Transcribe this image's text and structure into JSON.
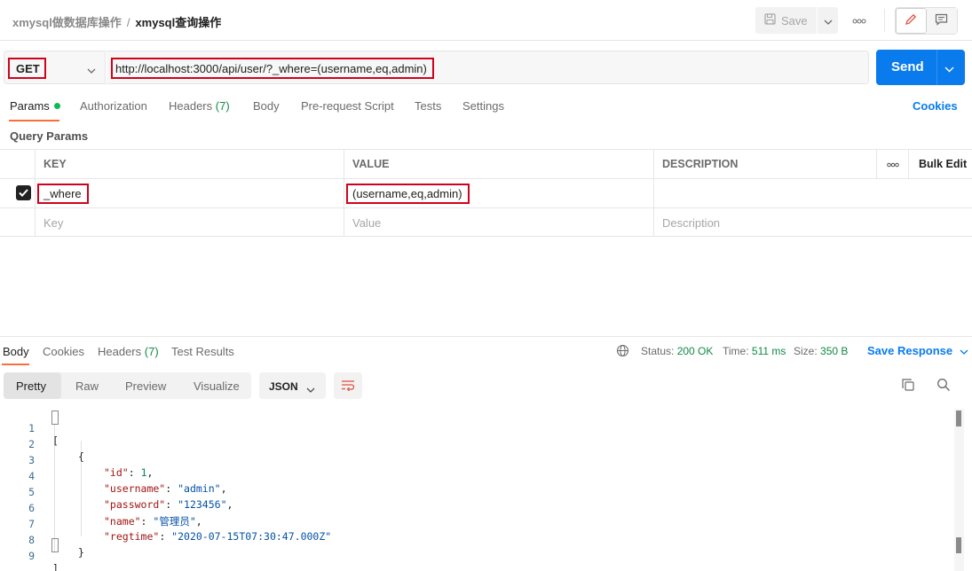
{
  "header": {
    "collection": "xmysql做数据库操作",
    "separator": "/",
    "request_name": "xmysql查询操作",
    "save_label": "Save",
    "more_icon": "ellipsis-icon"
  },
  "request": {
    "method": "GET",
    "url": "http://localhost:3000/api/user/?_where=(username,eq,admin)",
    "send_label": "Send"
  },
  "request_tabs": {
    "params": "Params",
    "authorization": "Authorization",
    "headers": "Headers",
    "headers_count": "(7)",
    "body": "Body",
    "prerequest": "Pre-request Script",
    "tests": "Tests",
    "settings": "Settings",
    "cookies": "Cookies"
  },
  "query_params": {
    "title": "Query Params",
    "columns": {
      "key": "KEY",
      "value": "VALUE",
      "description": "DESCRIPTION",
      "more": "ooo",
      "bulk_edit": "Bulk Edit"
    },
    "rows": [
      {
        "checked": true,
        "key": "_where",
        "value": "(username,eq,admin)",
        "description": ""
      }
    ],
    "placeholders": {
      "key": "Key",
      "value": "Value",
      "description": "Description"
    }
  },
  "response": {
    "tabs": {
      "body": "Body",
      "cookies": "Cookies",
      "headers": "Headers",
      "headers_count": "(7)",
      "test_results": "Test Results"
    },
    "status_label": "Status:",
    "status_value": "200 OK",
    "time_label": "Time:",
    "time_value": "511 ms",
    "size_label": "Size:",
    "size_value": "350 B",
    "save_response": "Save Response",
    "modes": [
      "Pretty",
      "Raw",
      "Preview",
      "Visualize"
    ],
    "format": "JSON",
    "lines": [
      "1",
      "2",
      "3",
      "4",
      "5",
      "6",
      "7",
      "8",
      "9"
    ],
    "json": {
      "id_key": "\"id\"",
      "id_val": "1",
      "username_key": "\"username\"",
      "username_val": "\"admin\"",
      "password_key": "\"password\"",
      "password_val": "\"123456\"",
      "name_key": "\"name\"",
      "name_val": "\"管理员\"",
      "regtime_key": "\"regtime\"",
      "regtime_val": "\"2020-07-15T07:30:47.000Z\""
    }
  },
  "colors": {
    "accent_blue": "#097bed",
    "highlight_red": "#d0021b",
    "tab_orange": "#ff6c37",
    "status_green": "#0f8a46"
  }
}
